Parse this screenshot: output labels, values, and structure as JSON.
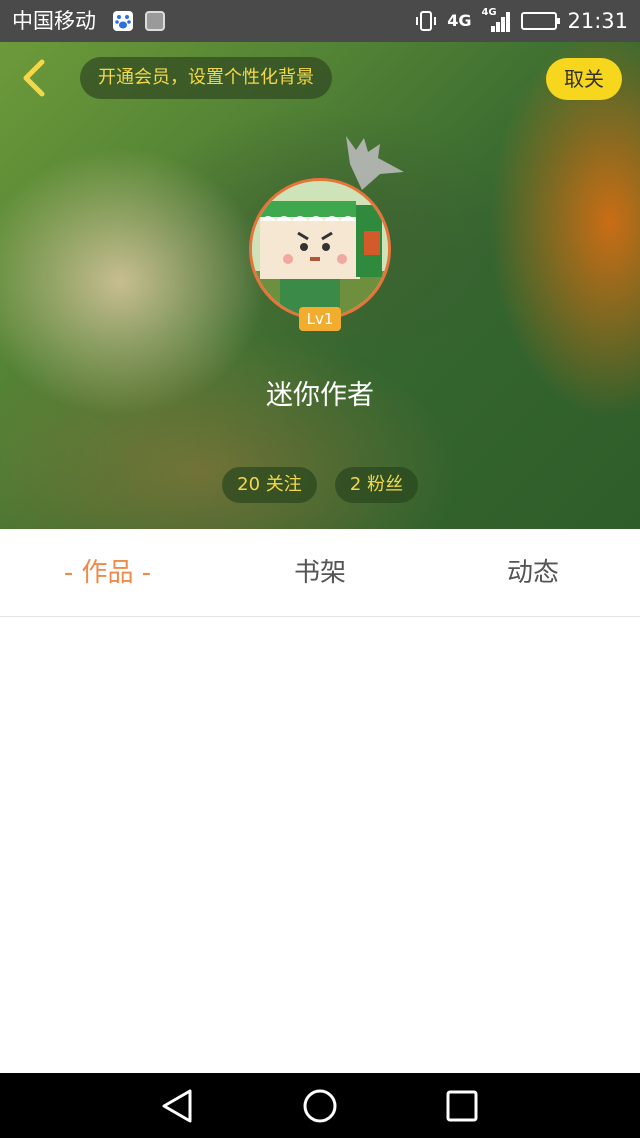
{
  "status_bar": {
    "carrier": "中国移动",
    "network": "4G",
    "network_small": "4G",
    "time": "21:31"
  },
  "header": {
    "vip_banner": "开通会员，设置个性化背景",
    "unfollow_label": "取关",
    "level": "Lv1",
    "username": "迷你作者",
    "following": "20 关注",
    "fans": "2 粉丝"
  },
  "tabs": [
    {
      "label": "- 作品 -",
      "active": true
    },
    {
      "label": "书架",
      "active": false
    },
    {
      "label": "动态",
      "active": false
    }
  ],
  "colors": {
    "accent_orange": "#f08a4b",
    "accent_yellow": "#f7d61e",
    "banner_text": "#f5d84a",
    "level_badge": "#f2ad2f"
  },
  "icons": [
    "back-chevron-icon",
    "bookmark-icon",
    "baidu-icon",
    "gallery-icon",
    "vibrate-icon",
    "signal-icon",
    "battery-icon",
    "nav-back-icon",
    "nav-home-icon",
    "nav-recent-icon"
  ]
}
